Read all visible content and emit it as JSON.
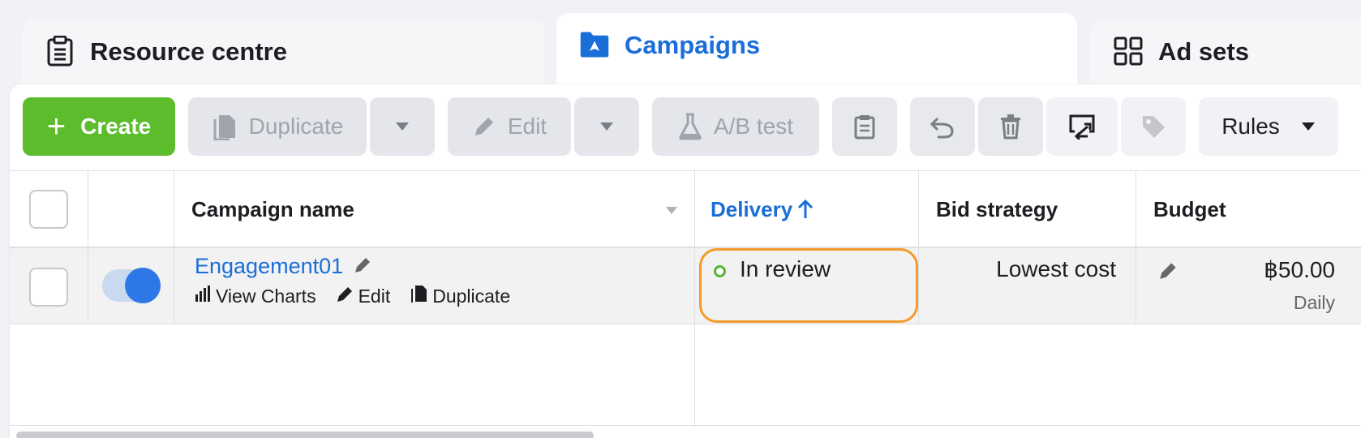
{
  "tabs": {
    "resource": "Resource centre",
    "campaigns": "Campaigns",
    "adsets": "Ad sets"
  },
  "toolbar": {
    "create": "Create",
    "duplicate": "Duplicate",
    "edit": "Edit",
    "ab_test": "A/B test",
    "rules": "Rules"
  },
  "table": {
    "headers": {
      "campaign_name": "Campaign name",
      "delivery": "Delivery",
      "bid_strategy": "Bid strategy",
      "budget": "Budget"
    },
    "rows": [
      {
        "name": "Engagement01",
        "actions": {
          "view_charts": "View Charts",
          "edit": "Edit",
          "duplicate": "Duplicate"
        },
        "delivery": "In review",
        "bid_strategy": "Lowest cost",
        "budget": "฿50.00",
        "budget_period": "Daily",
        "enabled": true
      }
    ]
  },
  "colors": {
    "accent": "#1a6ed8",
    "create_green": "#5cbc2c",
    "highlight_orange": "#f59a2b",
    "status_green": "#54b435"
  }
}
